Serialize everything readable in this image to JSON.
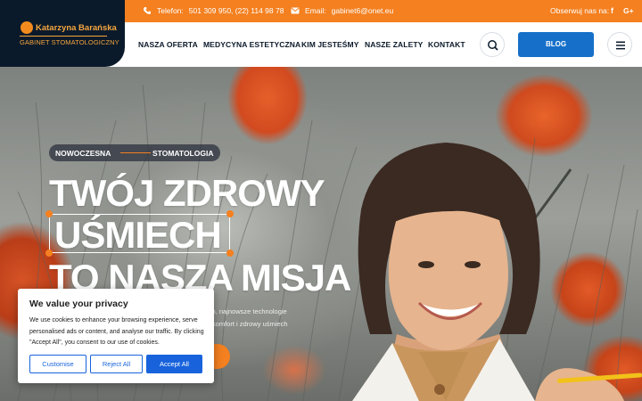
{
  "logo": {
    "name": "Katarzyna Barańska",
    "subtitle": "GABINET STOMATOLOGICZNY"
  },
  "topbar": {
    "phone_label": "Telefon:",
    "phone_value": "501 309 950, (22) 114 98 78",
    "email_label": "Email:",
    "email_value": "gabinet6@onet.eu",
    "follow_label": "Obserwuj nas na:",
    "social": [
      "f",
      "G+"
    ]
  },
  "nav": {
    "items": [
      "NASZA OFERTA",
      "MEDYCYNA ESTETYCZNA",
      "KIM JESTEŚMY",
      "NASZE ZALETY",
      "KONTAKT"
    ],
    "blog_label": "BLOG"
  },
  "hero": {
    "tag_left": "NOWOCZESNA",
    "tag_right": "STOMATOLOGIA",
    "headline": [
      "TWÓJ ZDROWY",
      "UŚMIECH",
      "TO NASZA MISJA"
    ],
    "desc_lines": [
      "ych, najnowsze technologie",
      "ój komfort i zdrowy uśmiech"
    ]
  },
  "cookie": {
    "title": "We value your privacy",
    "text": "We use cookies to enhance your browsing experience, serve personalised ads or content, and analyse our traffic. By clicking \"Accept All\", you consent to our use of cookies.",
    "customise": "Customise",
    "reject": "Reject All",
    "accept": "Accept All"
  },
  "colors": {
    "accent": "#f48020",
    "navy": "#0b1a2a",
    "blog_blue": "#1670c9",
    "cookie_blue": "#1863dc"
  },
  "icons": [
    "phone-icon",
    "mail-icon",
    "facebook-icon",
    "google-plus-icon",
    "search-icon",
    "menu-icon"
  ]
}
